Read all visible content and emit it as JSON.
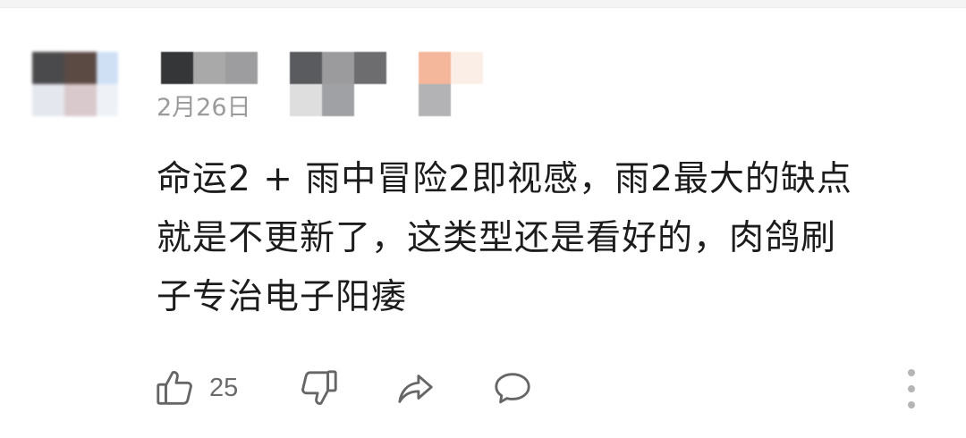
{
  "comment": {
    "timestamp": "2月26日",
    "text_lines": [
      "命运2 + 雨中冒险2即视感，雨2最大的缺点",
      "就是不更新了，这类型还是看好的，肉鸽刷",
      "子专治电子阳痿"
    ]
  },
  "actions": {
    "like_icon": "thumbs-up-icon",
    "like_count": "25",
    "dislike_icon": "thumbs-down-icon",
    "share_icon": "share-arrow-icon",
    "reply_icon": "speech-bubble-icon",
    "more_icon": "vertical-ellipsis-icon"
  },
  "colors": {
    "text": "#1c1c1c",
    "meta": "#9b9b9b",
    "icon": "#666666"
  }
}
